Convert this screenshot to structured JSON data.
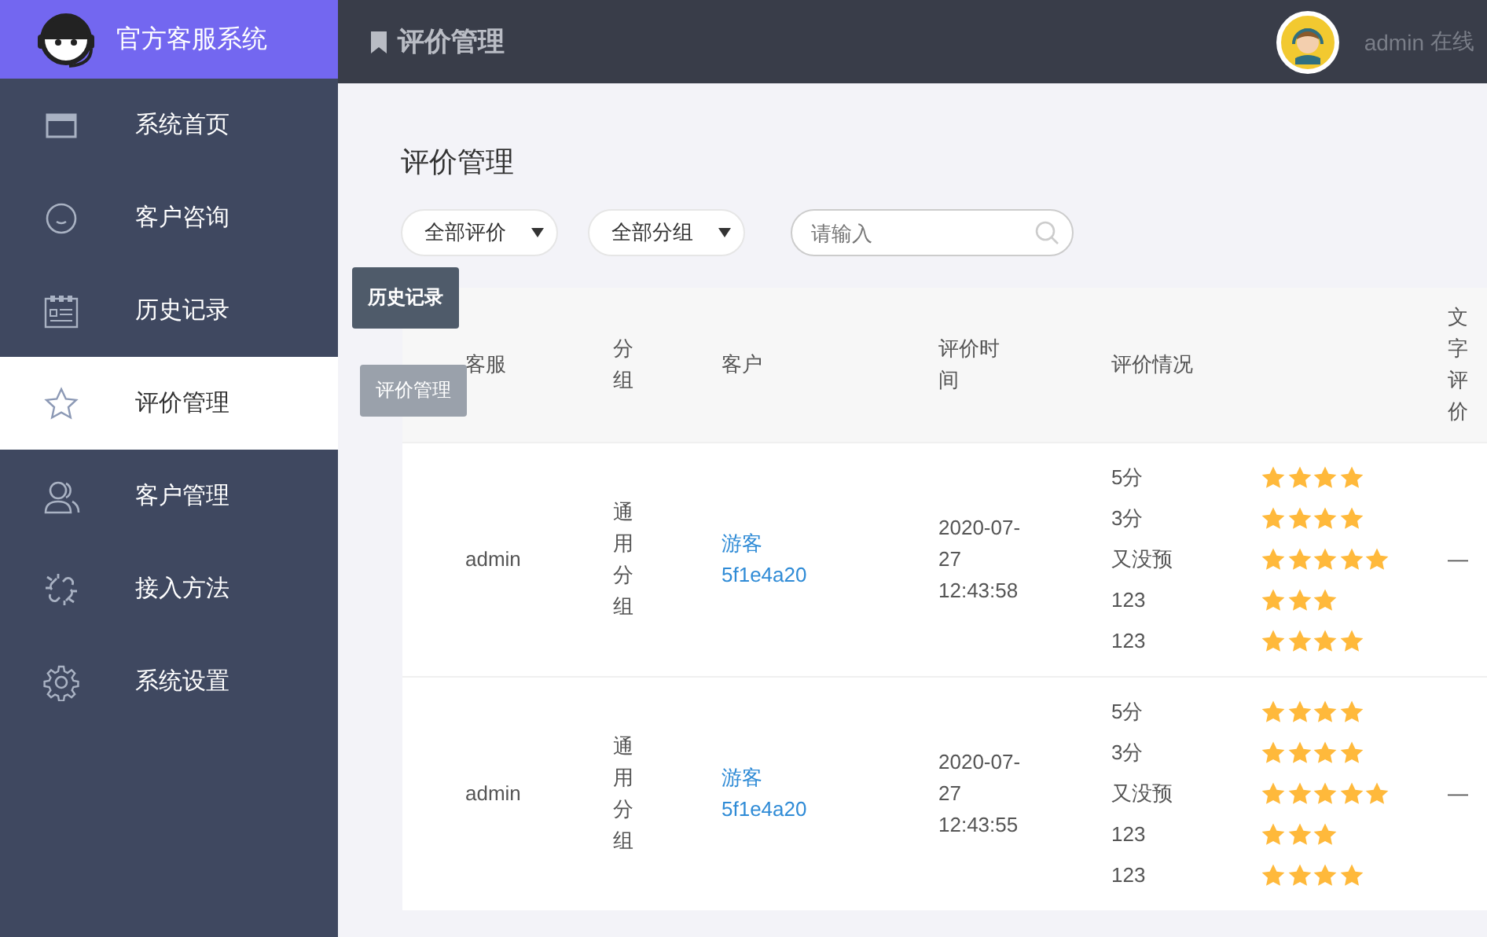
{
  "brand": {
    "title": "官方客服系统"
  },
  "header": {
    "page_title": "评价管理",
    "user": "admin",
    "status": "在线"
  },
  "sidebar": {
    "items": [
      {
        "label": "系统首页",
        "selected": false
      },
      {
        "label": "客户咨询",
        "selected": false
      },
      {
        "label": "历史记录",
        "selected": false
      },
      {
        "label": "评价管理",
        "selected": true
      },
      {
        "label": "客户管理",
        "selected": false
      },
      {
        "label": "接入方法",
        "selected": false
      },
      {
        "label": "系统设置",
        "selected": false
      }
    ]
  },
  "tooltips": [
    {
      "text": "历史记录",
      "faded": false
    },
    {
      "text": "评价管理",
      "faded": true
    }
  ],
  "content": {
    "title": "评价管理",
    "filters": [
      {
        "value": "全部评价"
      },
      {
        "value": "全部分组"
      }
    ],
    "search": {
      "placeholder": "请输入"
    },
    "table": {
      "columns": [
        "客服",
        "分组",
        "客户",
        "评价时间",
        "评价情况",
        "文字评价"
      ],
      "rows": [
        {
          "agent": "admin",
          "group": "通用分组",
          "customer": "游客 5f1e4a20",
          "time": "2020-07-27 12:43:58",
          "ratings": [
            {
              "label": "5分",
              "stars": 4
            },
            {
              "label": "3分",
              "stars": 4
            },
            {
              "label": "又没预",
              "stars": 5
            },
            {
              "label": "123",
              "stars": 3
            },
            {
              "label": "123",
              "stars": 4
            }
          ],
          "comment": "—"
        },
        {
          "agent": "admin",
          "group": "通用分组",
          "customer": "游客 5f1e4a20",
          "time": "2020-07-27 12:43:55",
          "ratings": [
            {
              "label": "5分",
              "stars": 4
            },
            {
              "label": "3分",
              "stars": 4
            },
            {
              "label": "又没预",
              "stars": 5
            },
            {
              "label": "123",
              "stars": 3
            },
            {
              "label": "123",
              "stars": 4
            }
          ],
          "comment": "—"
        }
      ]
    }
  }
}
